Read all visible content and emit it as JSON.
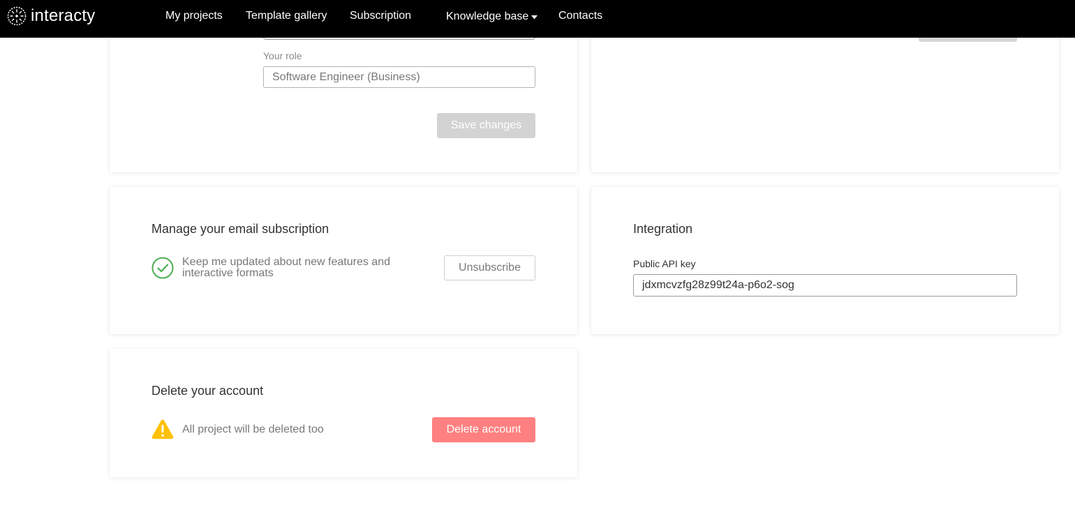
{
  "brand": {
    "name": "interacty"
  },
  "nav": {
    "items": [
      {
        "label": "My projects"
      },
      {
        "label": "Template gallery"
      },
      {
        "label": "Subscription"
      },
      {
        "label": "Knowledge base"
      },
      {
        "label": "Contacts"
      }
    ]
  },
  "profile": {
    "role_label": "Your role",
    "role_value": "Software Engineer (Business)",
    "save_label": "Save changes"
  },
  "email_subscription": {
    "title": "Manage your email subscription",
    "text": "Keep me updated about new features and interactive formats",
    "subscribed": true,
    "unsubscribe_label": "Unsubscribe"
  },
  "integration": {
    "title": "Integration",
    "api_label": "Public API key",
    "api_key": "jdxmcvzfg28z99t24a-p6o2-sog"
  },
  "delete_account": {
    "title": "Delete your account",
    "warning": "All project will be deleted too",
    "button_label": "Delete account"
  },
  "colors": {
    "topbar": "#000000",
    "success": "#4caf50",
    "warning": "#ffc107",
    "danger": "#ff8080",
    "disabled": "#d3d3d3"
  },
  "icons": {
    "logo": "interacty-logo-icon",
    "check": "check-circle-icon",
    "warning": "warning-triangle-icon",
    "caret": "caret-down-icon"
  }
}
